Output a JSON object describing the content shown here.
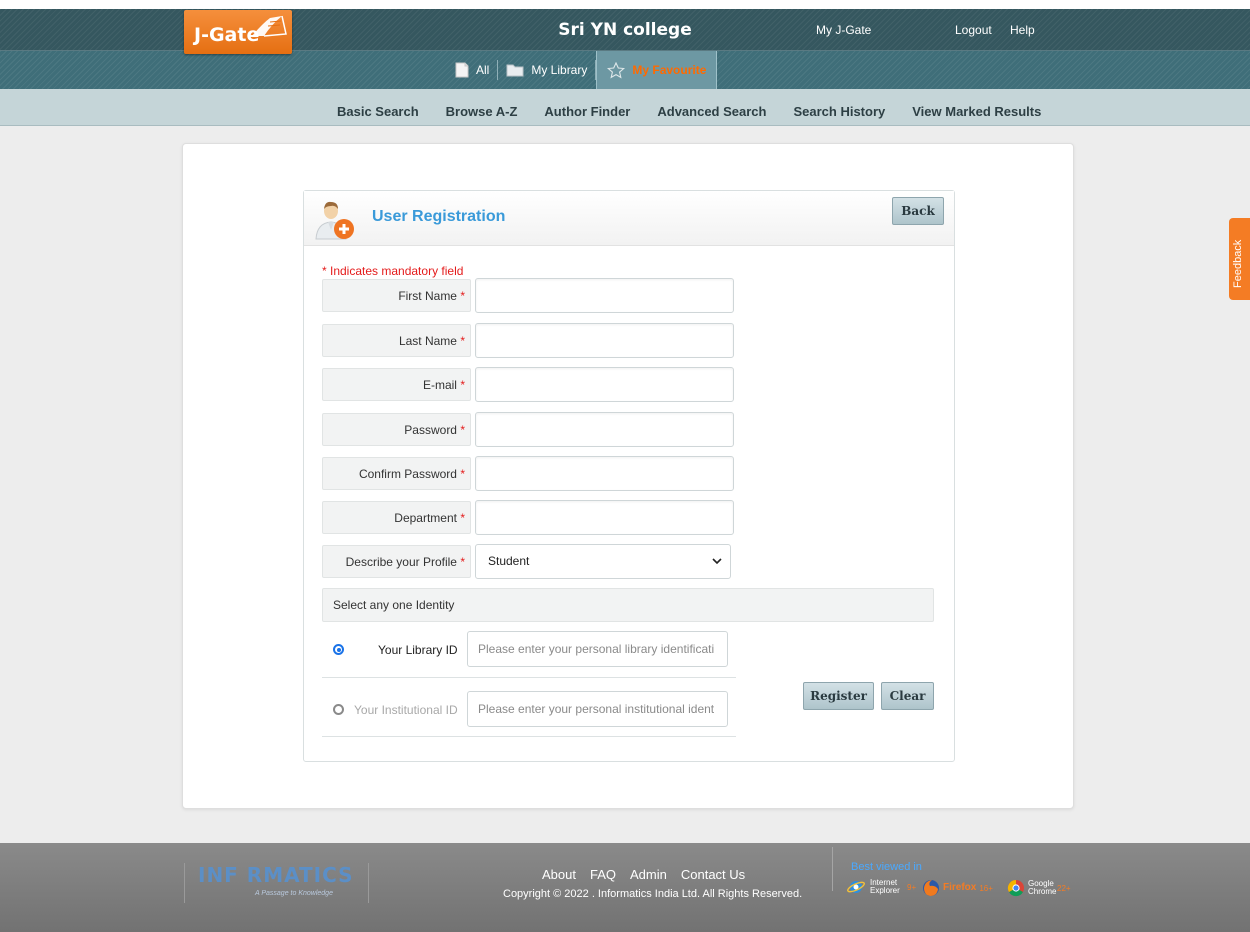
{
  "header": {
    "logo": "J-Gate",
    "college": "Sri YN college",
    "links": {
      "my_jgate": "My J-Gate",
      "logout": "Logout",
      "help": "Help"
    },
    "tabs": {
      "all": "All",
      "my_library": "My Library",
      "my_favourite": "My Favourite"
    },
    "active_tab": "My Favourite",
    "accent_color": "#ff6a00"
  },
  "subnav": {
    "basic_search": "Basic Search",
    "browse_az": "Browse A-Z",
    "author_finder": "Author Finder",
    "advanced_search": "Advanced Search",
    "search_history": "Search History",
    "view_marked": "View Marked Results"
  },
  "feedback": "Feedback",
  "form": {
    "title": "User Registration",
    "back": "Back",
    "mandatory_note": "* Indicates mandatory field",
    "fields": {
      "first_name": "First Name",
      "last_name": "Last Name",
      "email": "E-mail",
      "password": "Password",
      "confirm_password": "Confirm Password",
      "department": "Department",
      "profile": "Describe your Profile"
    },
    "star": "*",
    "profile_value": "Student",
    "identity_heading": "Select any one Identity",
    "library_id_label": "Your Library ID",
    "library_id_placeholder": "Please enter your personal library identificati",
    "institutional_id_label": "Your Institutional ID",
    "institutional_id_placeholder": "Please enter your personal institutional ident",
    "selected_identity": "Your Library ID",
    "register": "Register",
    "clear": "Clear"
  },
  "footer": {
    "logo": "INF RMATICS",
    "tagline": "A Passage to Knowledge",
    "links": {
      "about": "About",
      "faq": "FAQ",
      "admin": "Admin",
      "contact": "Contact Us"
    },
    "copyright": "Copyright © 2022 . Informatics India Ltd. All Rights Reserved.",
    "best_viewed": "Best viewed in",
    "browsers": {
      "ie_name": "Internet Explorer",
      "ie_version": "9+",
      "ff_name": "Firefox",
      "ff_version": "16+",
      "chrome_name": "Google Chrome",
      "chrome_version": "22+"
    }
  }
}
